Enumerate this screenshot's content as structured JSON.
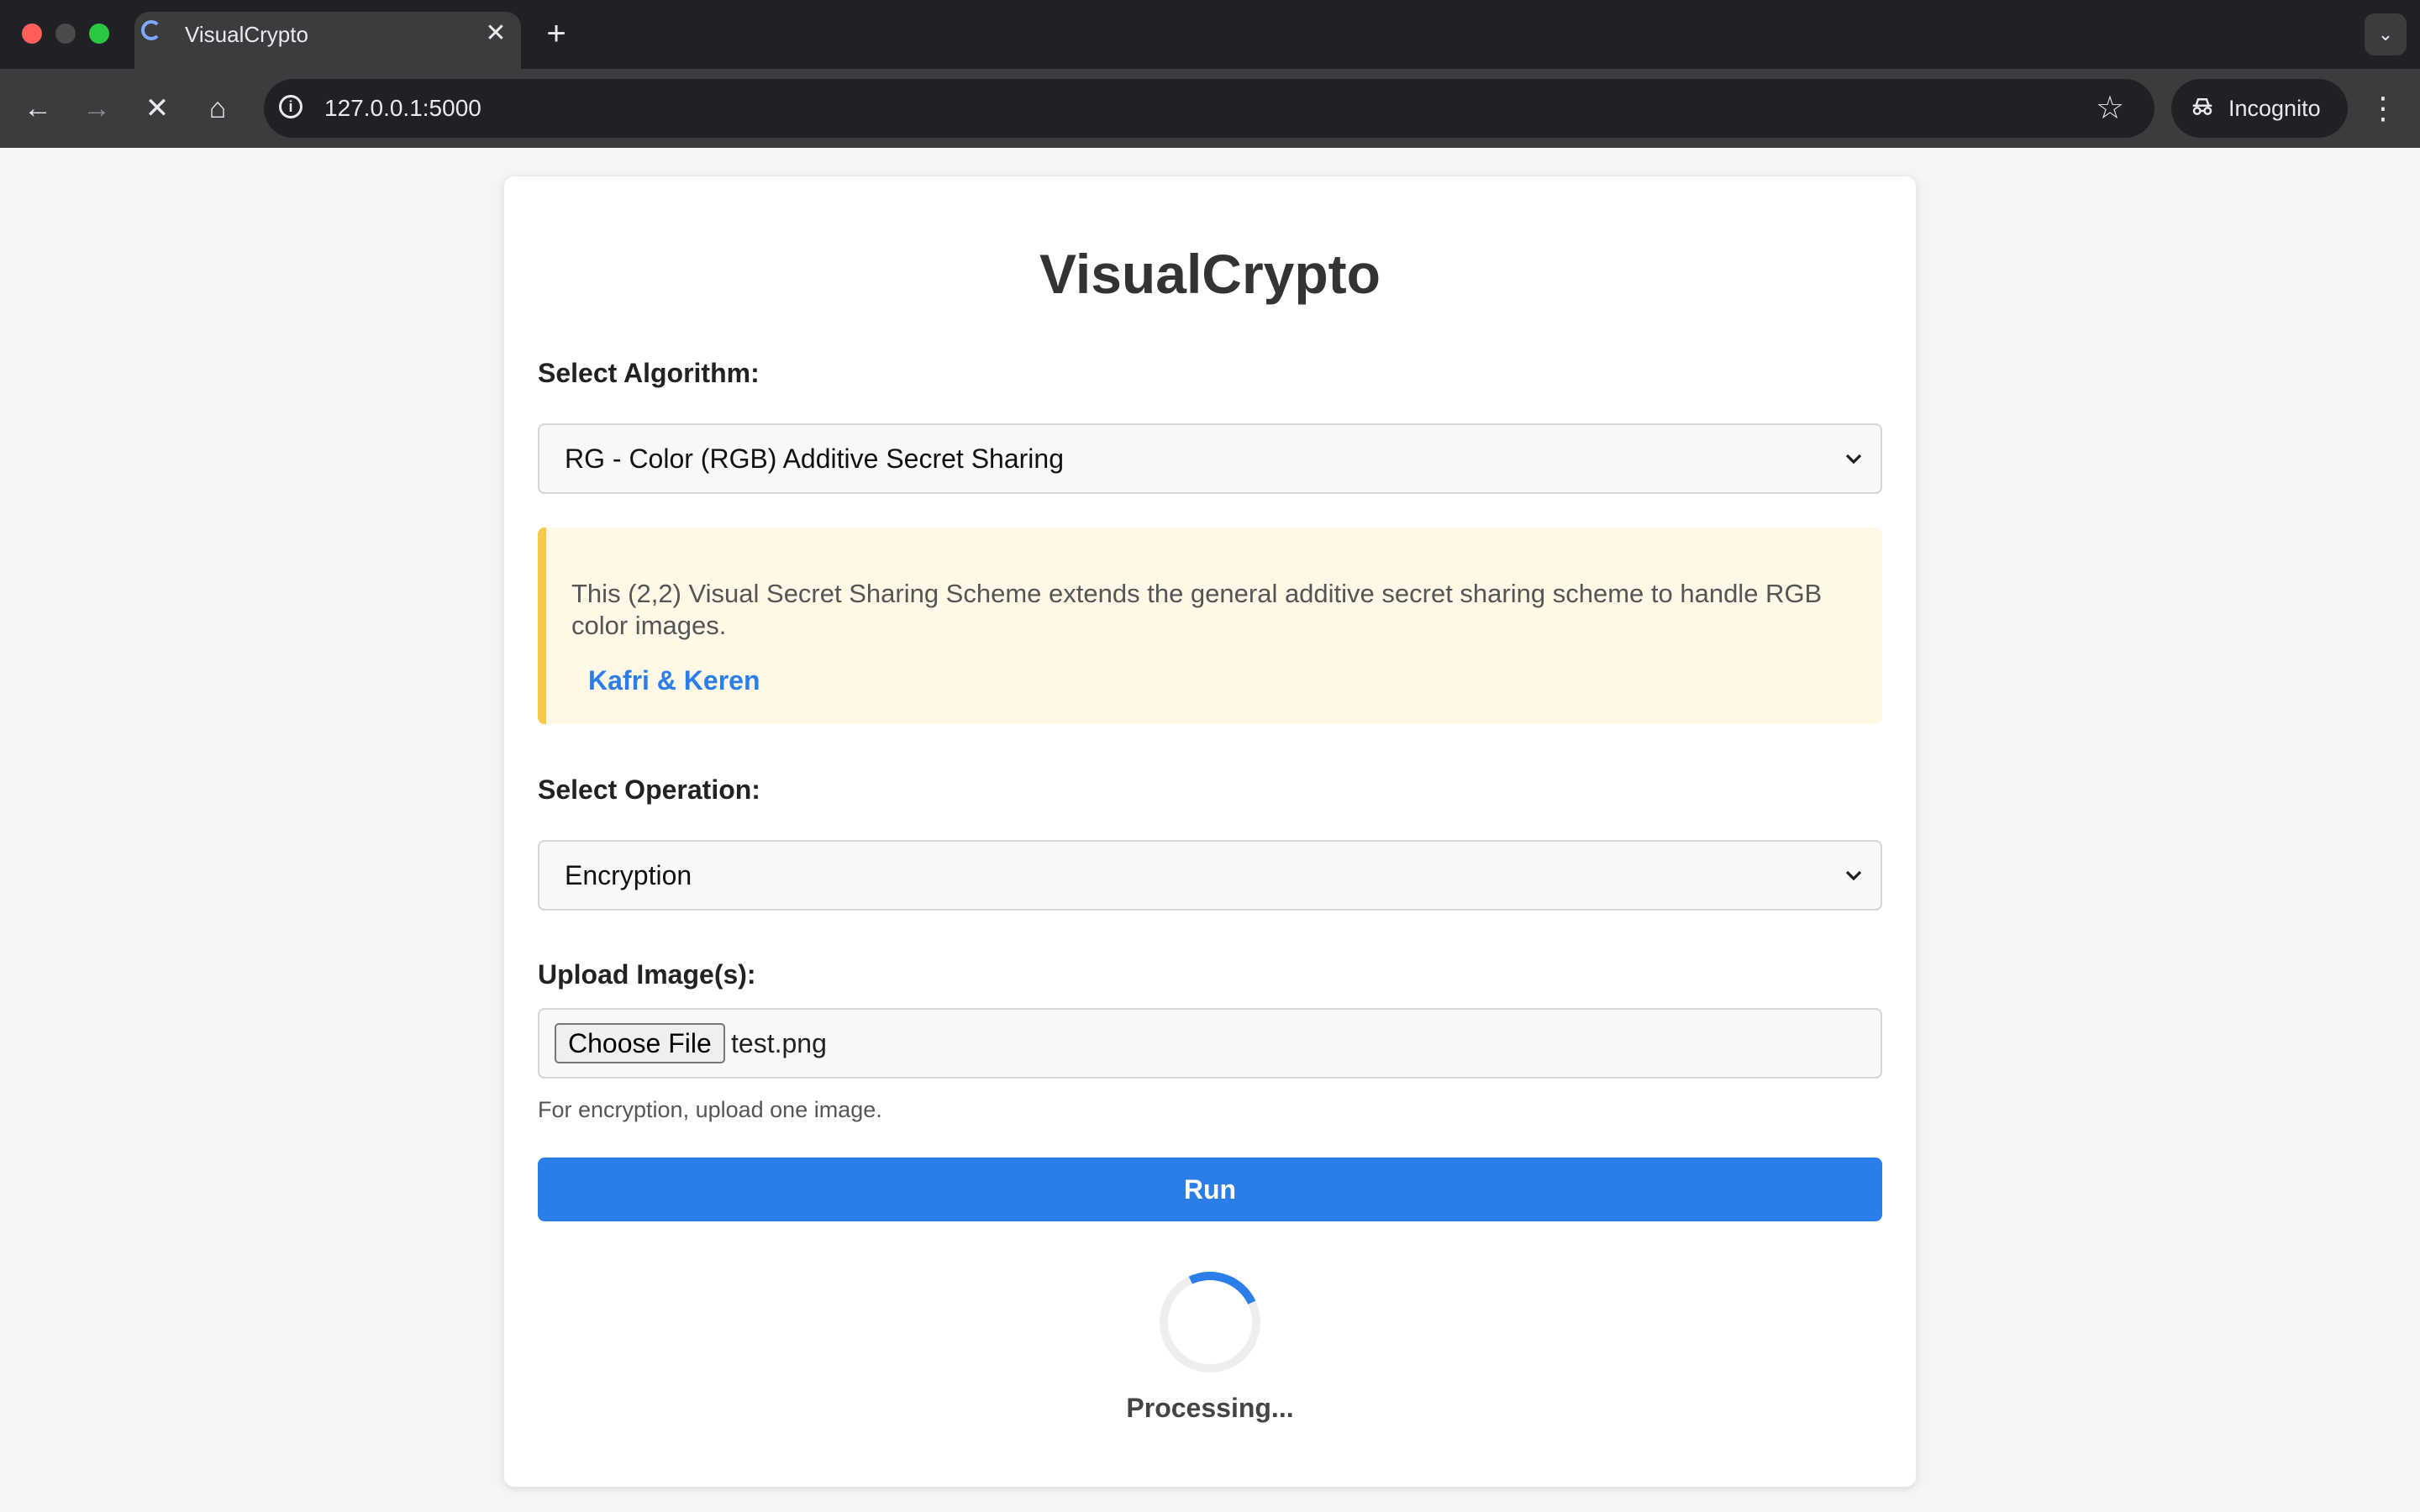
{
  "browser": {
    "tab_title": "VisualCrypto",
    "tab_close": "✕",
    "new_tab": "+",
    "tab_menu": "⌄",
    "back": "←",
    "forward": "→",
    "stop": "✕",
    "home": "⌂",
    "url": "127.0.0.1:5000",
    "info": "i",
    "star": "☆",
    "incognito_label": "Incognito",
    "incognito_icon": "incognito-icon",
    "menu": "⋮",
    "loading": true
  },
  "page": {
    "title": "VisualCrypto",
    "algorithm": {
      "label": "Select Algorithm:",
      "selected": "RG - Color (RGB) Additive Secret Sharing"
    },
    "info": {
      "description": "This (2,2) Visual Secret Sharing Scheme extends the general additive secret sharing scheme to handle RGB color images.",
      "link_text": "Kafri & Keren"
    },
    "operation": {
      "label": "Select Operation:",
      "selected": "Encryption"
    },
    "upload": {
      "label": "Upload Image(s):",
      "button_label": "Choose File",
      "file_name": "test.png",
      "hint": "For encryption, upload one image."
    },
    "run_label": "Run",
    "status": "Processing..."
  },
  "colors": {
    "accent": "#2b7de9",
    "info_border": "#f7c948",
    "info_background": "#fff8e6",
    "page_background": "#f5f5f5"
  }
}
